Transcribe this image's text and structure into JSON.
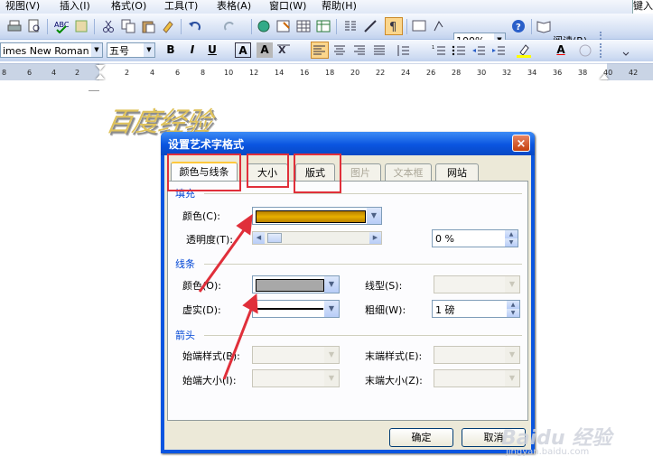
{
  "menu": {
    "items": [
      "视图(V)",
      "插入(I)",
      "格式(O)",
      "工具(T)",
      "表格(A)",
      "窗口(W)",
      "帮助(H)"
    ],
    "help_box": "键入"
  },
  "toolbar": {
    "zoom": "100%",
    "reading_button": "阅读(R)",
    "font_name": "imes New Roman",
    "font_size": "五号",
    "bold": "B",
    "italic": "I",
    "underline": "U",
    "char_border": "A",
    "char_shade": "A",
    "font_color_letter": "A"
  },
  "ruler": {
    "numbers": [
      "8",
      "6",
      "4",
      "2",
      "2",
      "4",
      "6",
      "8",
      "10",
      "12",
      "14",
      "16",
      "18",
      "20",
      "22",
      "24",
      "26",
      "28",
      "30",
      "32",
      "34",
      "36",
      "38",
      "40",
      "42"
    ]
  },
  "document": {
    "wordart_text": "百度经验"
  },
  "dialog": {
    "title": "设置艺术字格式",
    "close": "×",
    "tabs": [
      {
        "label": "颜色与线条",
        "state": "active"
      },
      {
        "label": "大小",
        "state": "normal"
      },
      {
        "label": "版式",
        "state": "normal"
      },
      {
        "label": "图片",
        "state": "disabled"
      },
      {
        "label": "文本框",
        "state": "disabled"
      },
      {
        "label": "网站",
        "state": "normal"
      }
    ],
    "fill": {
      "section": "填充",
      "color_label": "颜色(C):",
      "color_value": "#e0a800",
      "transparency_label": "透明度(T):",
      "transparency_value": "0 %"
    },
    "line": {
      "section": "线条",
      "color_label": "颜色(O):",
      "color_value": "#a8a8a8",
      "dash_label": "虚实(D):",
      "style_label": "线型(S):",
      "weight_label": "粗细(W):",
      "weight_value": "1 磅"
    },
    "arrows": {
      "section": "箭头",
      "begin_style_label": "始端样式(B):",
      "begin_size_label": "始端大小(I):",
      "end_style_label": "末端样式(E):",
      "end_size_label": "末端大小(Z):"
    },
    "ok": "确定",
    "cancel": "取消"
  },
  "watermark": {
    "brand": "Baidu 经验",
    "url": "jingyan.baidu.com"
  },
  "annotation_color": "#e02f3a"
}
